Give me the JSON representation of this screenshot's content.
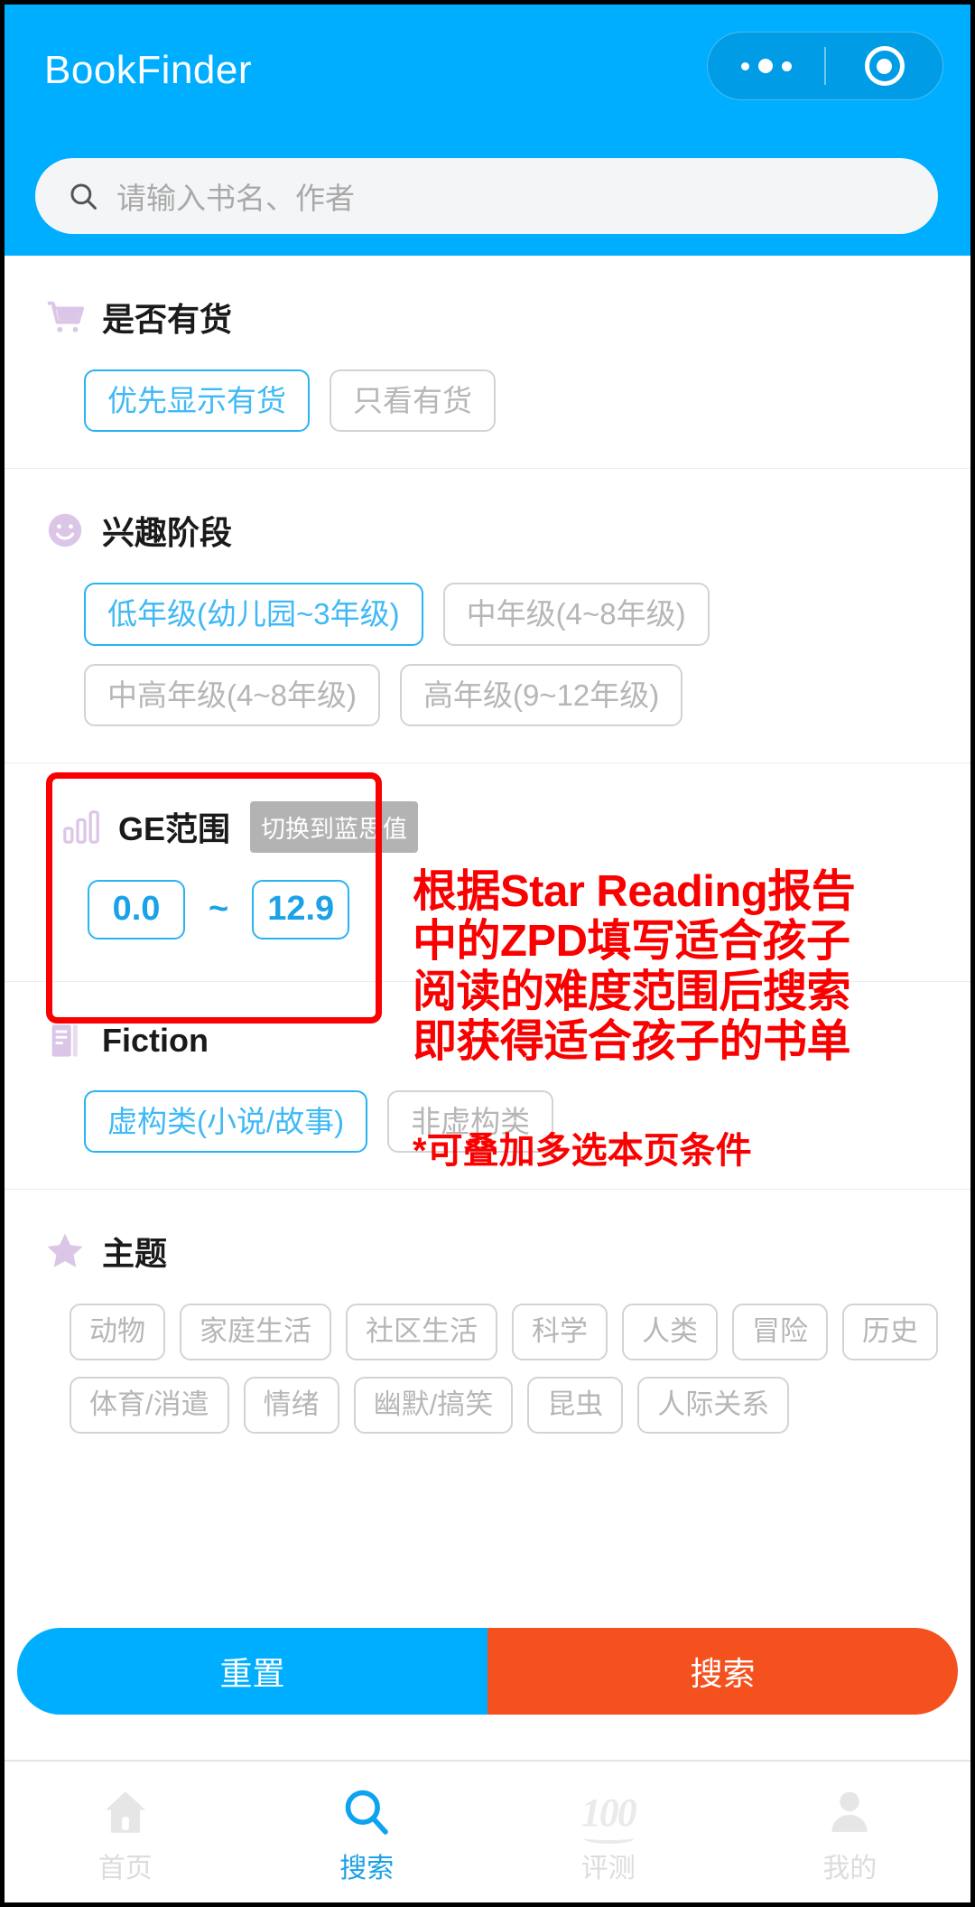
{
  "header": {
    "app_title": "BookFinder",
    "capsule": {
      "more_icon": "more-dots-icon",
      "target_icon": "target-circle-icon"
    }
  },
  "search": {
    "icon": "search-icon",
    "placeholder": "请输入书名、作者",
    "value": ""
  },
  "sections": [
    {
      "id": "stock",
      "icon": "cart-icon",
      "title": "是否有货",
      "chips": [
        {
          "label": "优先显示有货",
          "selected": true
        },
        {
          "label": "只看有货",
          "selected": false
        }
      ]
    },
    {
      "id": "interest-stage",
      "icon": "smiley-icon",
      "title": "兴趣阶段",
      "chips": [
        {
          "label": "低年级(幼儿园~3年级)",
          "selected": true
        },
        {
          "label": "中年级(4~8年级)",
          "selected": false
        },
        {
          "label": "中高年级(4~8年级)",
          "selected": false
        },
        {
          "label": "高年级(9~12年级)",
          "selected": false
        }
      ]
    },
    {
      "id": "fiction",
      "icon": "book-icon",
      "title": "Fiction",
      "chips": [
        {
          "label": "虚构类(小说/故事)",
          "selected": true
        },
        {
          "label": "非虚构类",
          "selected": false
        }
      ]
    },
    {
      "id": "theme",
      "icon": "star-icon",
      "title": "主题",
      "chips": [
        {
          "label": "动物",
          "selected": false
        },
        {
          "label": "家庭生活",
          "selected": false
        },
        {
          "label": "社区生活",
          "selected": false
        },
        {
          "label": "科学",
          "selected": false
        },
        {
          "label": "人类",
          "selected": false
        },
        {
          "label": "冒险",
          "selected": false
        },
        {
          "label": "历史",
          "selected": false
        },
        {
          "label": "体育/消遣",
          "selected": false
        },
        {
          "label": "情绪",
          "selected": false
        },
        {
          "label": "幽默/搞笑",
          "selected": false
        },
        {
          "label": "昆虫",
          "selected": false
        },
        {
          "label": "人际关系",
          "selected": false
        }
      ]
    }
  ],
  "ge_section": {
    "icon": "bar-chart-icon",
    "title": "GE范围",
    "switch_button": "切换到蓝思值",
    "min_value": "0.0",
    "separator": "~",
    "max_value": "12.9"
  },
  "annotation": {
    "main_text": "根据Star Reading报告\n中的ZPD填写适合孩子\n阅读的难度范围后搜索\n即获得适合孩子的书单",
    "note_text": "*可叠加多选本页条件",
    "color": "#FA0000"
  },
  "action_bar": {
    "reset_label": "重置",
    "search_label": "搜索",
    "reset_color": "#00AEFF",
    "search_color": "#F4511E"
  },
  "tabbar": {
    "items": [
      {
        "label": "首页",
        "icon": "home-icon",
        "active": false
      },
      {
        "label": "搜索",
        "icon": "search-icon",
        "active": true
      },
      {
        "label": "评测",
        "icon": "hundred-points-icon",
        "active": false
      },
      {
        "label": "我的",
        "icon": "person-icon",
        "active": false
      }
    ],
    "active_color": "#1BA1E8",
    "inactive_color": "#DCDCDC"
  },
  "theme_colors": {
    "brand_blue": "#00AEFF",
    "accent_blue": "#29B3F2",
    "icon_purple": "#DCC6E8",
    "chip_gray": "#D3D3D3"
  }
}
